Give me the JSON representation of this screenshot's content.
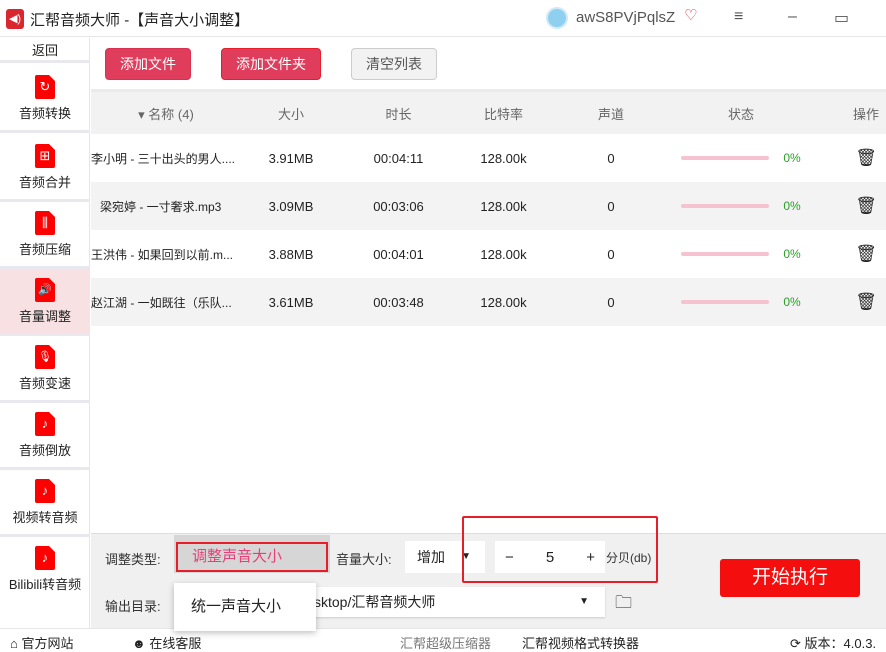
{
  "titlebar": {
    "app_name": "汇帮音频大师",
    "page_title": "-【声音大小调整】",
    "username": "awS8PVjPqlsZ",
    "vip_icon": "vip-diamond-icon",
    "menu_icon": "≡",
    "min_icon": "–",
    "max_icon": "▭"
  },
  "sidebar": {
    "back": "返回",
    "items": [
      {
        "label": "音频转换",
        "icon": "↻"
      },
      {
        "label": "音频合并",
        "icon": "⊞"
      },
      {
        "label": "音频压缩",
        "icon": "⫼"
      },
      {
        "label": "音量调整",
        "icon": "🔊"
      },
      {
        "label": "音频变速",
        "icon": "🎙"
      },
      {
        "label": "音频倒放",
        "icon": "♪"
      },
      {
        "label": "视频转音频",
        "icon": "♪"
      },
      {
        "label": "Bilibili转音频",
        "icon": "♪"
      }
    ]
  },
  "toolbar": {
    "add_file": "添加文件",
    "add_folder": "添加文件夹",
    "clear_list": "清空列表"
  },
  "table": {
    "headers": [
      "▾ 名称 (4)",
      "大小",
      "时长",
      "比特率",
      "声道",
      "状态",
      "操作"
    ],
    "rows": [
      {
        "name": "李小明 - 三十出头的男人....",
        "size": "3.91MB",
        "duration": "00:04:11",
        "bitrate": "128.00k",
        "channels": "0",
        "progress": "0%"
      },
      {
        "name": "梁宛婷 - 一寸奢求.mp3",
        "size": "3.09MB",
        "duration": "00:03:06",
        "bitrate": "128.00k",
        "channels": "0",
        "progress": "0%"
      },
      {
        "name": "王洪伟 - 如果回到以前.m...",
        "size": "3.88MB",
        "duration": "00:04:01",
        "bitrate": "128.00k",
        "channels": "0",
        "progress": "0%"
      },
      {
        "name": "赵江湖 - 一如既往（乐队...",
        "size": "3.61MB",
        "duration": "00:03:48",
        "bitrate": "128.00k",
        "channels": "0",
        "progress": "0%"
      }
    ]
  },
  "settings": {
    "type_label": "调整类型:",
    "type_value": "调整声音大小",
    "type_option2": "统一声音大小",
    "volume_label": "音量大小:",
    "volume_dir": "增加",
    "volume_value": "5",
    "unit": "分贝(db)",
    "output_label": "输出目录:",
    "output_value": "sktop/汇帮音频大师",
    "start": "开始执行"
  },
  "footer": {
    "website": "官方网站",
    "support": "在线客服",
    "link1": "汇帮超级压缩器",
    "link2": "汇帮视频格式转换器",
    "version": "版本：4.0.3."
  }
}
